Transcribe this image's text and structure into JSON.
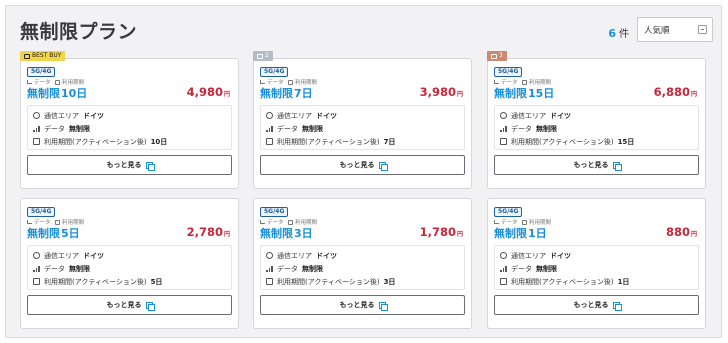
{
  "page": {
    "title": "無制限プラン",
    "count_number": "6",
    "count_suffix": "件",
    "sort_value": "人気順"
  },
  "colors": {
    "accent": "#1a8fd6",
    "price": "#c8283c",
    "best_badge": "#f0d44a"
  },
  "labels": {
    "network": "5G/4G",
    "data": "データ",
    "period": "利用期間",
    "area": "通信エリア",
    "data_row": "データ",
    "period_row": "利用期間(アクティベーション後)",
    "more_button": "もっと見る",
    "yen": "円"
  },
  "cards": [
    {
      "badge": "BEST BUY",
      "data": "無制限",
      "days": "10日",
      "price": "4,980",
      "area": "ドイツ",
      "data_value": "無制限",
      "period_value": "10日"
    },
    {
      "badge": "2",
      "data": "無制限",
      "days": "7日",
      "price": "3,980",
      "area": "ドイツ",
      "data_value": "無制限",
      "period_value": "7日"
    },
    {
      "badge": "3",
      "data": "無制限",
      "days": "15日",
      "price": "6,880",
      "area": "ドイツ",
      "data_value": "無制限",
      "period_value": "15日"
    },
    {
      "badge": "",
      "data": "無制限",
      "days": "5日",
      "price": "2,780",
      "area": "ドイツ",
      "data_value": "無制限",
      "period_value": "5日"
    },
    {
      "badge": "",
      "data": "無制限",
      "days": "3日",
      "price": "1,780",
      "area": "ドイツ",
      "data_value": "無制限",
      "period_value": "3日"
    },
    {
      "badge": "",
      "data": "無制限",
      "days": "1日",
      "price": "880",
      "area": "ドイツ",
      "data_value": "無制限",
      "period_value": "1日"
    }
  ]
}
